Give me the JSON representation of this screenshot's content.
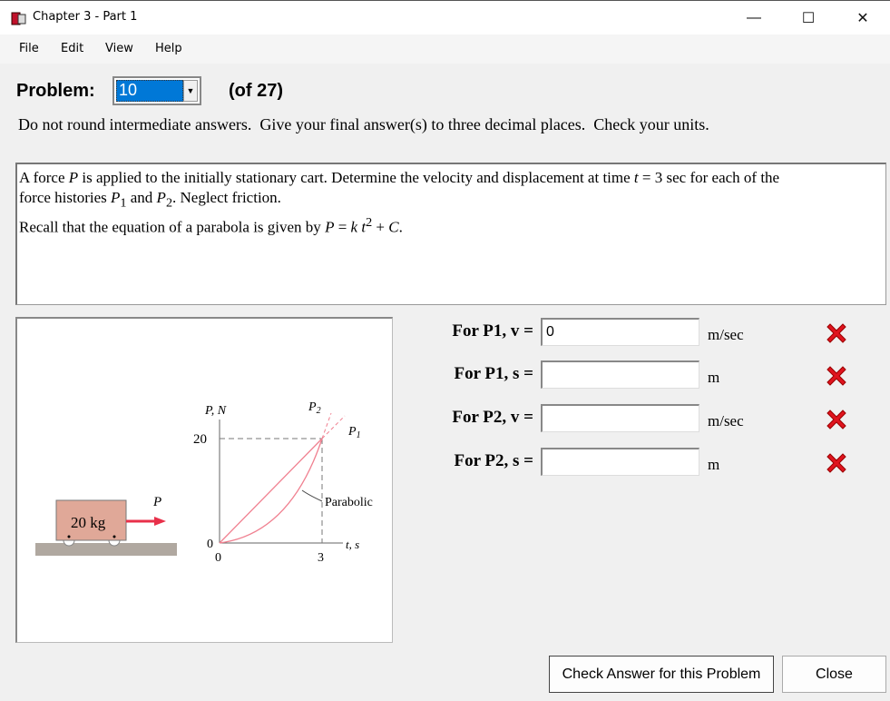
{
  "window": {
    "title": "Chapter 3 - Part 1",
    "minimize": "—",
    "maximize": "☐",
    "close": "✕"
  },
  "menu": [
    "File",
    "Edit",
    "View",
    "Help"
  ],
  "problem": {
    "label": "Problem:",
    "selected": "10",
    "of": "(of 27)"
  },
  "instructions": "Do not round intermediate answers.  Give your final answer(s) to three decimal places.  Check your units.",
  "question": {
    "l1a": "A force ",
    "P": "P",
    "l1b": " is applied to the initially stationary cart.  Determine the velocity and displacement at time ",
    "t": "t",
    "l1c": " = 3 sec for each of the",
    "l2a": "force histories ",
    "P1": "P",
    "sub1": "1",
    "l2b": " and ",
    "P2": "P",
    "sub2": "2",
    "l2c": ". Neglect friction.",
    "l3a": "Recall that the equation of a parabola is given by ",
    "eqP": "P",
    "eqmid": " = ",
    "eqk": "k t",
    "sup": "2",
    "eqend": " + ",
    "eqC": "C",
    "dot": "."
  },
  "diagram": {
    "mass": "20 kg",
    "force": "P",
    "yaxis": "P, N",
    "xaxis": "t, s",
    "y_tick": "20",
    "y0": "0",
    "x0": "0",
    "x_tick": "3",
    "p1": "P",
    "p1sub": "1",
    "p2": "P",
    "p2sub": "2",
    "parabolic": "Parabolic",
    "curve_color": "#f08090",
    "arrow_color": "#e8304a",
    "cart_color": "#e0a898"
  },
  "answers": [
    {
      "label": "For P1, v =",
      "value": "0",
      "unit": "m/sec",
      "status": "incorrect"
    },
    {
      "label": "For P1, s =",
      "value": "",
      "unit": "m",
      "status": "incorrect"
    },
    {
      "label": "For P2, v =",
      "value": "",
      "unit": "m/sec",
      "status": "incorrect"
    },
    {
      "label": "For P2, s =",
      "value": "",
      "unit": "m",
      "status": "incorrect"
    }
  ],
  "buttons": {
    "check": "Check Answer for this Problem",
    "close": "Close"
  }
}
